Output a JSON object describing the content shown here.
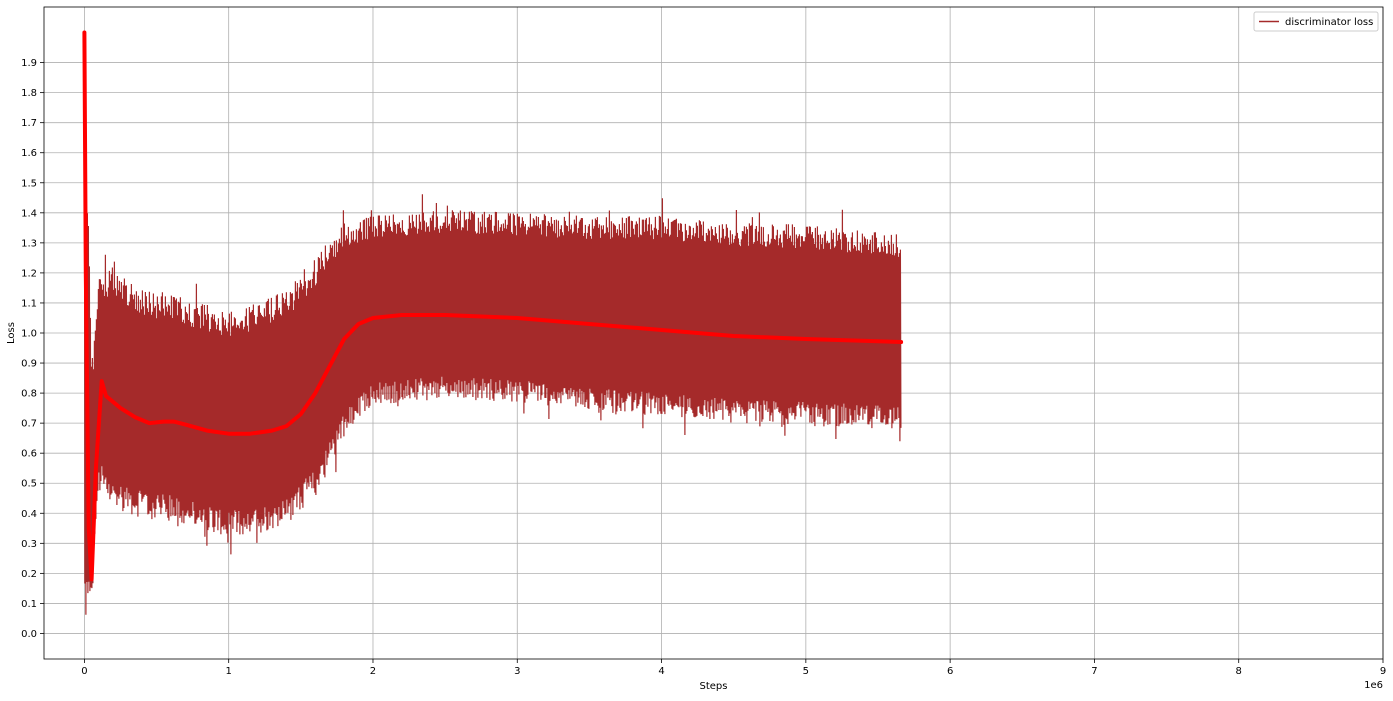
{
  "chart_data": {
    "type": "line",
    "title": "",
    "xlabel": "Steps",
    "ylabel": "Loss",
    "x_offset_label": "1e6",
    "xlim": [
      -0.28,
      9.0
    ],
    "ylim": [
      -0.085,
      2.085
    ],
    "x_ticks": [
      0,
      1,
      2,
      3,
      4,
      5,
      6,
      7,
      8,
      9
    ],
    "x_tick_labels": [
      "0",
      "1",
      "2",
      "3",
      "4",
      "5",
      "6",
      "7",
      "8",
      "9"
    ],
    "y_ticks": [
      0.0,
      0.1,
      0.2,
      0.3,
      0.4,
      0.5,
      0.6,
      0.7,
      0.8,
      0.9,
      1.0,
      1.1,
      1.2,
      1.3,
      1.4,
      1.5,
      1.6,
      1.7,
      1.8,
      1.9
    ],
    "y_tick_labels": [
      "0.0",
      "0.1",
      "0.2",
      "0.3",
      "0.4",
      "0.5",
      "0.6",
      "0.7",
      "0.8",
      "0.9",
      "1.0",
      "1.1",
      "1.2",
      "1.3",
      "1.4",
      "1.5",
      "1.6",
      "1.7",
      "1.8",
      "1.9"
    ],
    "grid": true,
    "legend": {
      "position": "top-right",
      "entries": [
        "discriminator loss"
      ]
    },
    "series": [
      {
        "name": "discriminator loss",
        "color": "#a52a2a",
        "style": "noisy band",
        "x": [
          0.0,
          0.05,
          0.1,
          0.2,
          0.4,
          0.6,
          0.8,
          1.0,
          1.2,
          1.4,
          1.6,
          1.8,
          2.0,
          2.5,
          3.0,
          3.5,
          4.0,
          4.5,
          5.0,
          5.66
        ],
        "lower": [
          0.02,
          0.05,
          0.5,
          0.42,
          0.38,
          0.37,
          0.35,
          0.32,
          0.33,
          0.36,
          0.45,
          0.65,
          0.76,
          0.78,
          0.77,
          0.74,
          0.72,
          0.7,
          0.69,
          0.68
        ],
        "upper": [
          2.0,
          0.9,
          1.2,
          1.22,
          1.15,
          1.13,
          1.1,
          1.08,
          1.1,
          1.14,
          1.25,
          1.37,
          1.39,
          1.41,
          1.4,
          1.39,
          1.39,
          1.37,
          1.36,
          1.33
        ]
      },
      {
        "color": "#ff0000",
        "style": "smoothed",
        "x": [
          0.0,
          0.01,
          0.03,
          0.05,
          0.08,
          0.12,
          0.15,
          0.25,
          0.35,
          0.45,
          0.55,
          0.62,
          0.7,
          0.85,
          1.0,
          1.15,
          1.3,
          1.4,
          1.5,
          1.6,
          1.7,
          1.8,
          1.9,
          2.0,
          2.2,
          2.5,
          3.0,
          3.5,
          4.0,
          4.5,
          5.0,
          5.66
        ],
        "y": [
          2.0,
          1.2,
          0.35,
          0.18,
          0.55,
          0.84,
          0.79,
          0.75,
          0.72,
          0.7,
          0.705,
          0.705,
          0.695,
          0.675,
          0.665,
          0.665,
          0.675,
          0.69,
          0.73,
          0.8,
          0.89,
          0.98,
          1.03,
          1.05,
          1.06,
          1.06,
          1.05,
          1.03,
          1.01,
          0.99,
          0.98,
          0.97
        ]
      }
    ]
  }
}
